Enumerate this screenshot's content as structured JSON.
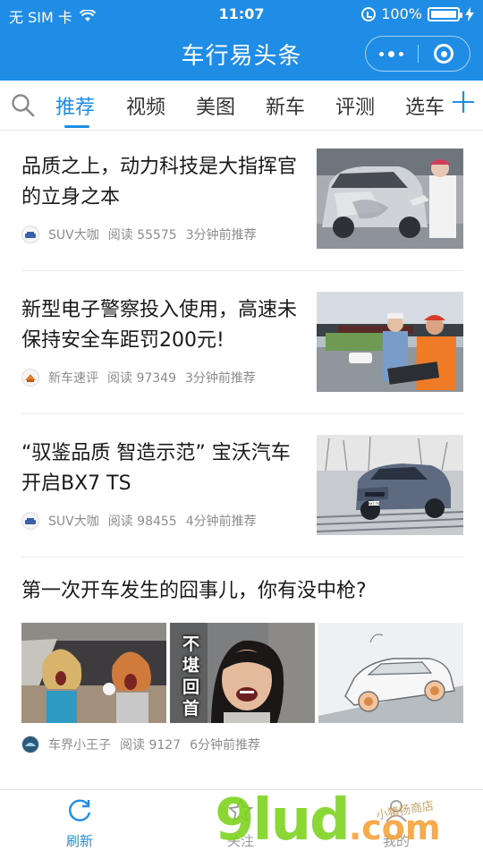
{
  "status_bar": {
    "carrier": "无 SIM 卡",
    "time": "11:07",
    "battery": "100%",
    "battery_level": 1.0
  },
  "header": {
    "title": "车行易头条"
  },
  "tabs": {
    "items": [
      "推荐",
      "视频",
      "美图",
      "新车",
      "评测",
      "选车"
    ],
    "active_index": 0
  },
  "articles": [
    {
      "title": "品质之上，动力科技是大指挥官的立身之本",
      "source": "SUV大咖",
      "reads": "阅读 55575",
      "time": "3分钟前推荐"
    },
    {
      "title": "新型电子警察投入使用，高速未保持安全车距罚200元!",
      "source": "新车速评",
      "reads": "阅读 97349",
      "time": "3分钟前推荐"
    },
    {
      "title": "“驭鉴品质  智造示范” 宝沃汽车开启BX7 TS",
      "source": "SUV大咖",
      "reads": "阅读 98455",
      "time": "4分钟前推荐",
      "image_caption": "BX7 TS"
    },
    {
      "title": "第一次开车发生的囧事儿，你有没中枪?",
      "source": "车界小王子",
      "reads": "阅读 9127",
      "time": "6分钟前推荐",
      "image_caption": "不堪回首"
    }
  ],
  "bottom_nav": {
    "refresh": "刷新",
    "follow": "关注",
    "mine": "我的"
  },
  "watermark": {
    "main": "9lud",
    "suffix": ".com",
    "small": "小猪扬商店"
  },
  "colors": {
    "brand": "#1f8ce6",
    "text": "#1a1a1a",
    "meta": "#8c8c8c"
  }
}
